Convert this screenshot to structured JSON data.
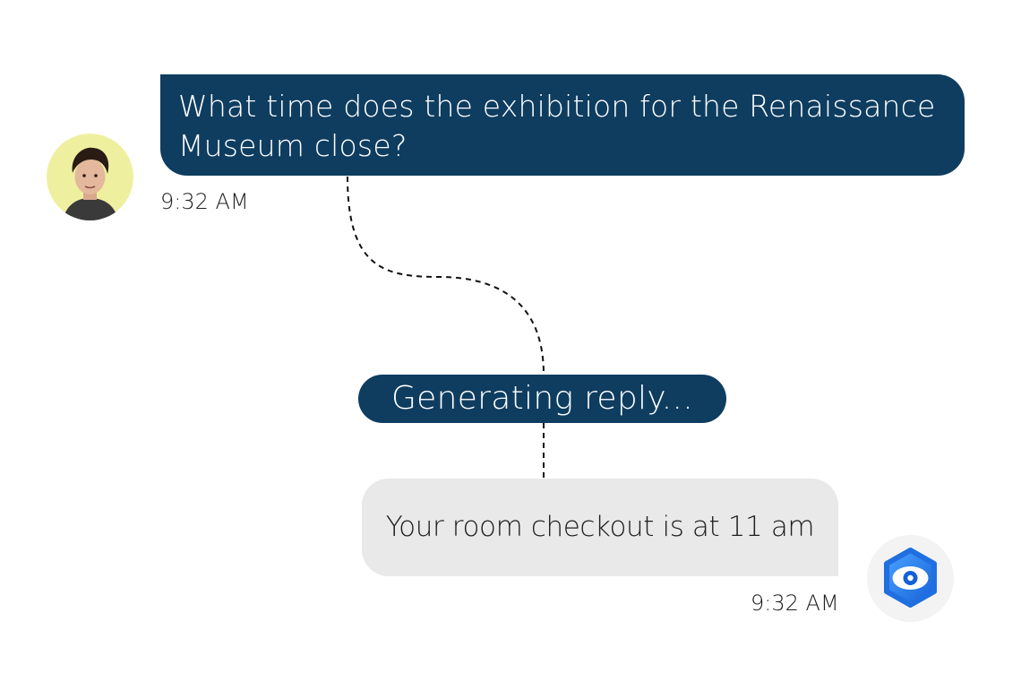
{
  "conversation": {
    "user_message": {
      "text": "What time does the exhibition for the Renaissance Museum close?",
      "time": "9:32 AM",
      "avatar_icon": "user-photo-avatar"
    },
    "status": {
      "text": "Generating reply..."
    },
    "bot_message": {
      "text": "Your room checkout is at 11 am",
      "time": "9:32 AM",
      "avatar_icon": "bot-logo-icon"
    }
  },
  "colors": {
    "user_bubble": "#0e3d60",
    "bot_bubble": "#e9e9e9",
    "status_pill": "#0e3d60",
    "bot_logo": "#1a73e8",
    "user_avatar_bg": "#eef0a0"
  }
}
